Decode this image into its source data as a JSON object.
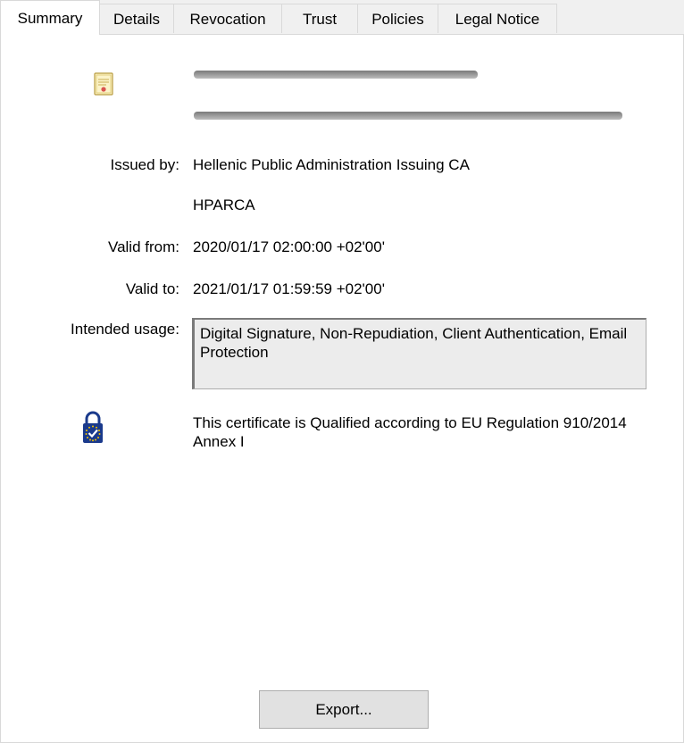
{
  "tabs": [
    {
      "label": "Summary",
      "active": true
    },
    {
      "label": "Details",
      "active": false
    },
    {
      "label": "Revocation",
      "active": false
    },
    {
      "label": "Trust",
      "active": false
    },
    {
      "label": "Policies",
      "active": false
    },
    {
      "label": "Legal Notice",
      "active": false
    }
  ],
  "icons": {
    "certificate": "certificate-icon",
    "qualified": "eu-qualified-lock-icon"
  },
  "summary": {
    "issued_by_label": "Issued by:",
    "issued_by_line1": "Hellenic Public Administration Issuing CA",
    "issued_by_line2": "HPARCA",
    "valid_from_label": "Valid from:",
    "valid_from_value": "2020/01/17 02:00:00 +02'00'",
    "valid_to_label": "Valid to:",
    "valid_to_value": "2021/01/17 01:59:59 +02'00'",
    "intended_usage_label": "Intended usage:",
    "intended_usage_value": "Digital Signature, Non-Repudiation, Client Authentication, Email Protection",
    "qualified_text": "This certificate is Qualified according to EU Regulation 910/2014 Annex I"
  },
  "export_label": "Export...",
  "colors": {
    "window_bg": "#f0f0f0",
    "panel_bg": "#ffffff",
    "lock_blue": "#1a3a8c",
    "star_yellow": "#f2c200"
  }
}
